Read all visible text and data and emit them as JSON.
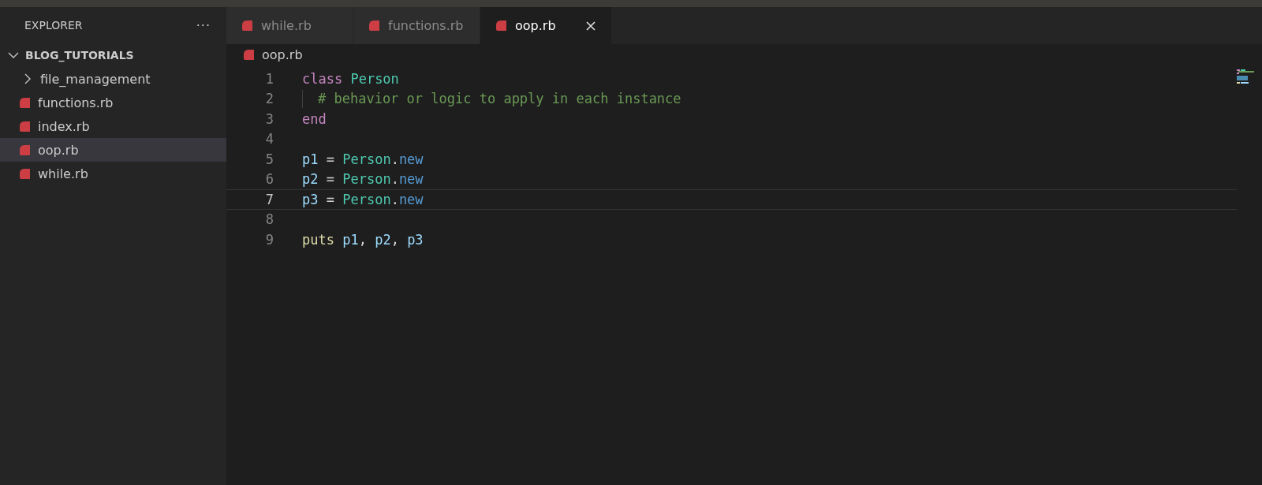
{
  "sidebar": {
    "title": "EXPLORER",
    "more": "···",
    "folder": {
      "label": "BLOG_TUTORIALS",
      "expanded": true,
      "children": [
        {
          "kind": "folder",
          "label": "file_management",
          "expanded": false,
          "selected": false
        },
        {
          "kind": "file",
          "label": "functions.rb",
          "selected": false
        },
        {
          "kind": "file",
          "label": "index.rb",
          "selected": false
        },
        {
          "kind": "file",
          "label": "oop.rb",
          "selected": true
        },
        {
          "kind": "file",
          "label": "while.rb",
          "selected": false
        }
      ]
    }
  },
  "tabs": [
    {
      "label": "while.rb",
      "selected": false
    },
    {
      "label": "functions.rb",
      "selected": false
    },
    {
      "label": "oop.rb",
      "selected": true
    }
  ],
  "breadcrumb": "oop.rb",
  "editor": {
    "lines": [
      {
        "number": "1",
        "current": false,
        "tokens": [
          {
            "kind": "keyword",
            "text": "class "
          },
          {
            "kind": "class",
            "text": "Person"
          }
        ]
      },
      {
        "number": "2",
        "current": false,
        "indented": true,
        "tokens": [
          {
            "kind": "comment",
            "text": "# behavior or logic to apply in each instance"
          }
        ]
      },
      {
        "number": "3",
        "current": false,
        "tokens": [
          {
            "kind": "keyword",
            "text": "end"
          }
        ]
      },
      {
        "number": "4",
        "current": false
      },
      {
        "number": "5",
        "current": false,
        "tokens": [
          {
            "kind": "variable",
            "text": "p1 "
          },
          {
            "kind": "plain",
            "text": "= "
          },
          {
            "kind": "class",
            "text": "Person"
          },
          {
            "kind": "plain",
            "text": "."
          },
          {
            "kind": "method",
            "text": "new"
          }
        ]
      },
      {
        "number": "6",
        "current": false,
        "tokens": [
          {
            "kind": "variable",
            "text": "p2 "
          },
          {
            "kind": "plain",
            "text": "= "
          },
          {
            "kind": "class",
            "text": "Person"
          },
          {
            "kind": "plain",
            "text": "."
          },
          {
            "kind": "method",
            "text": "new"
          }
        ]
      },
      {
        "number": "7",
        "current": true,
        "tokens": [
          {
            "kind": "variable",
            "text": "p3 "
          },
          {
            "kind": "plain",
            "text": "= "
          },
          {
            "kind": "class",
            "text": "Person"
          },
          {
            "kind": "plain",
            "text": "."
          },
          {
            "kind": "method",
            "text": "new"
          }
        ]
      },
      {
        "number": "8",
        "current": false
      },
      {
        "number": "9",
        "current": false,
        "tokens": [
          {
            "kind": "function",
            "text": "puts "
          },
          {
            "kind": "variable",
            "text": "p1"
          },
          {
            "kind": "plain",
            "text": ", "
          },
          {
            "kind": "variable",
            "text": "p2"
          },
          {
            "kind": "plain",
            "text": ", "
          },
          {
            "kind": "variable",
            "text": "p3"
          }
        ]
      }
    ]
  }
}
